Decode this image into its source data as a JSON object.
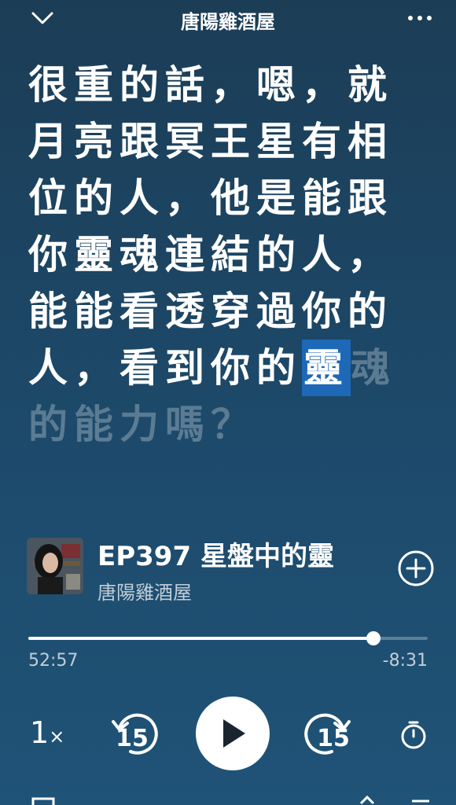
{
  "header": {
    "title": "唐陽雞酒屋"
  },
  "lyrics": {
    "lines": [
      "很重的話，嗯，就",
      "月亮跟冥王星有相",
      "位的人，他是能跟",
      "你靈魂連結的人，",
      "能能看透穿過你的"
    ],
    "line6_before": "人，看到你的",
    "line6_highlight": "靈",
    "line6_after": "魂",
    "line7": "的能力嗎？"
  },
  "episode": {
    "title": "EP397 星盤中的靈",
    "show": "唐陽雞酒屋"
  },
  "playback": {
    "elapsed": "52:57",
    "remaining": "-8:31",
    "progress_fraction": 0.864,
    "speed": "1",
    "speed_suffix": "×",
    "skip_back_seconds": "15",
    "skip_forward_seconds": "15"
  },
  "colors": {
    "background_top": "#1c3d56",
    "background_bottom": "#1f5377",
    "highlight": "#1e68b8"
  },
  "icons": {
    "collapse": "chevron-down-icon",
    "more": "more-dots-icon",
    "add": "add-circle-icon",
    "play": "play-icon",
    "skip_back": "skip-back-15-icon",
    "skip_forward": "skip-forward-15-icon",
    "sleep_timer": "timer-icon"
  }
}
